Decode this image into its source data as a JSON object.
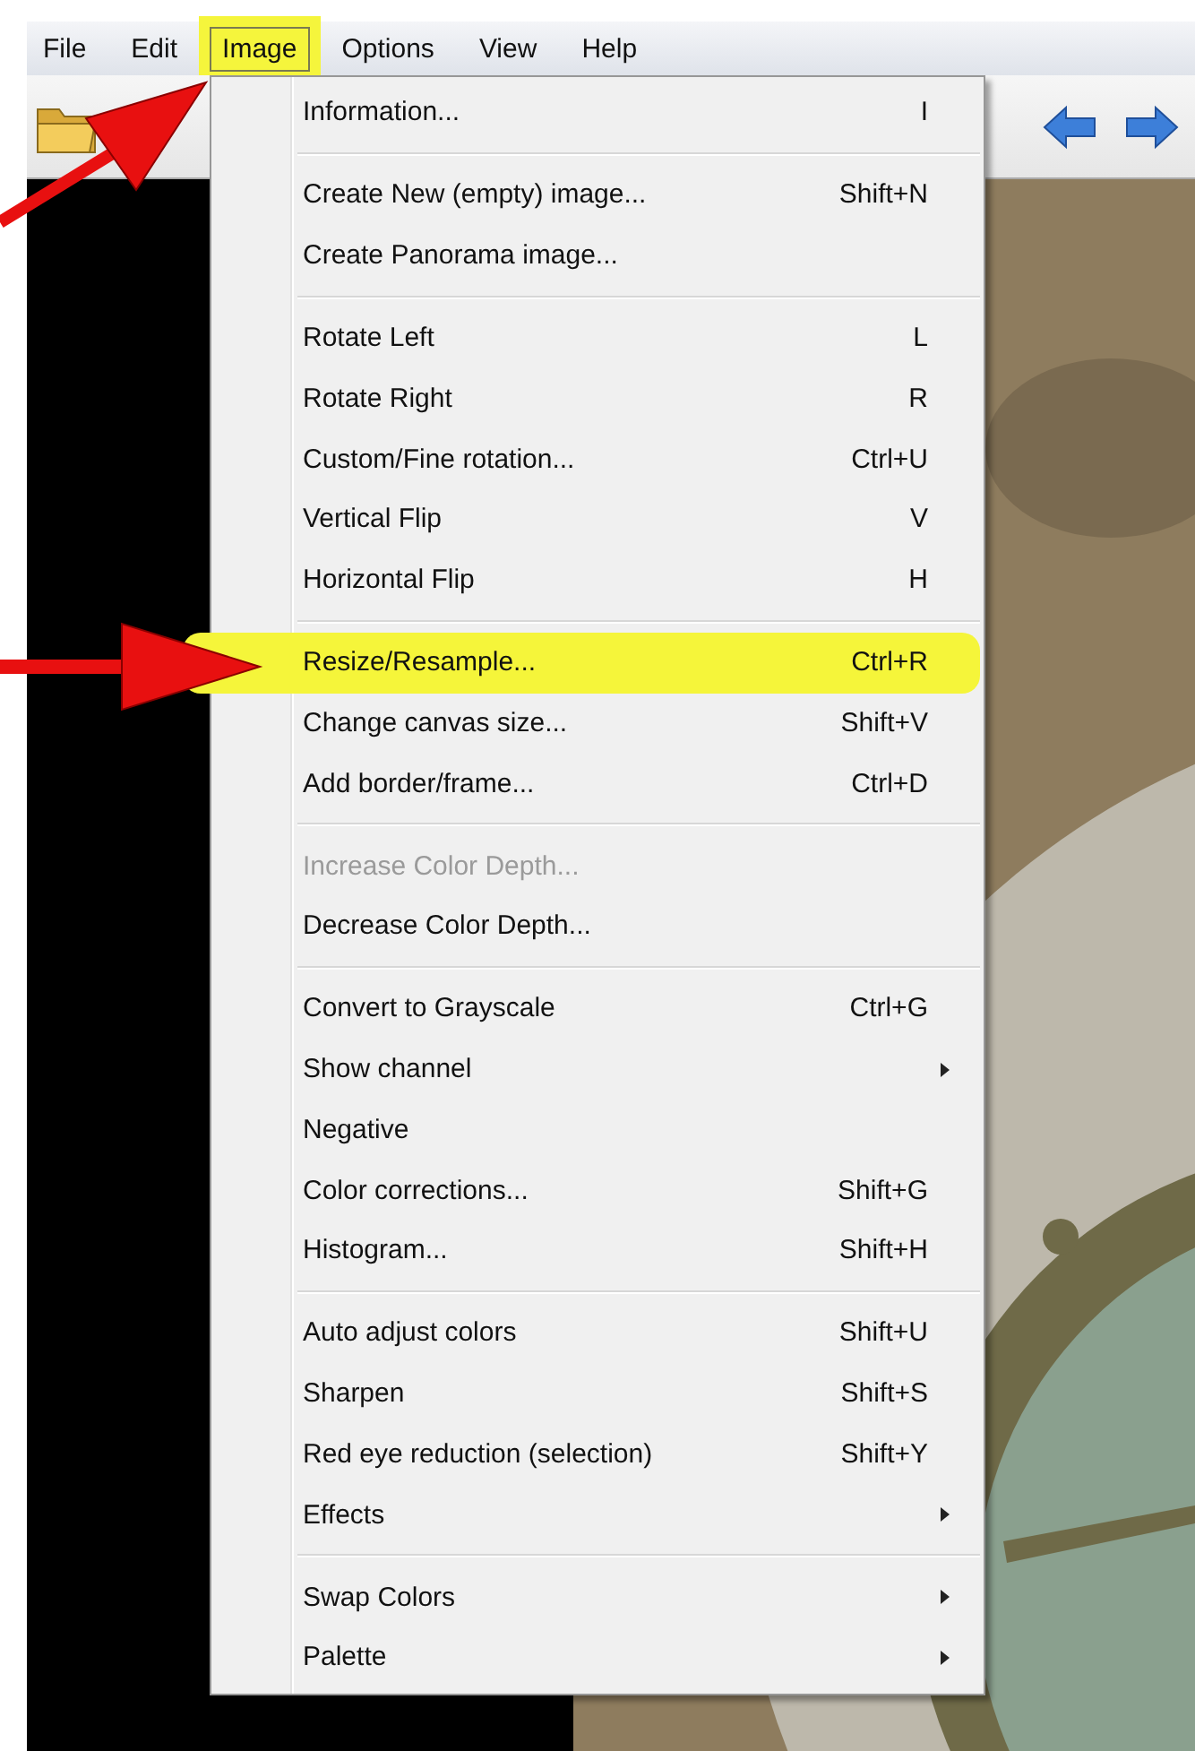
{
  "menubar": [
    {
      "label": "File",
      "selected": false
    },
    {
      "label": "Edit",
      "selected": false
    },
    {
      "label": "Image",
      "selected": true
    },
    {
      "label": "Options",
      "selected": false
    },
    {
      "label": "View",
      "selected": false
    },
    {
      "label": "Help",
      "selected": false
    }
  ],
  "menu": {
    "groups": [
      [
        {
          "label": "Information...",
          "shortcut": "I",
          "disabled": false,
          "submenu": false,
          "highlighted": false
        }
      ],
      [
        {
          "label": "Create New (empty) image...",
          "shortcut": "Shift+N",
          "disabled": false,
          "submenu": false,
          "highlighted": false
        },
        {
          "label": "Create Panorama image...",
          "disabled": false,
          "submenu": false,
          "highlighted": false
        }
      ],
      [
        {
          "label": "Rotate Left",
          "shortcut": "L",
          "disabled": false,
          "submenu": false,
          "highlighted": false
        },
        {
          "label": "Rotate Right",
          "shortcut": "R",
          "disabled": false,
          "submenu": false,
          "highlighted": false
        },
        {
          "label": "Custom/Fine rotation...",
          "shortcut": "Ctrl+U",
          "disabled": false,
          "submenu": false,
          "highlighted": false
        },
        {
          "label": "Vertical Flip",
          "shortcut": "V",
          "disabled": false,
          "submenu": false,
          "highlighted": false
        },
        {
          "label": "Horizontal Flip",
          "shortcut": "H",
          "disabled": false,
          "submenu": false,
          "highlighted": false
        }
      ],
      [
        {
          "label": "Resize/Resample...",
          "shortcut": "Ctrl+R",
          "disabled": false,
          "submenu": false,
          "highlighted": true
        },
        {
          "label": "Change canvas size...",
          "shortcut": "Shift+V",
          "disabled": false,
          "submenu": false,
          "highlighted": false
        },
        {
          "label": "Add border/frame...",
          "shortcut": "Ctrl+D",
          "disabled": false,
          "submenu": false,
          "highlighted": false
        }
      ],
      [
        {
          "label": "Increase Color Depth...",
          "disabled": true,
          "submenu": false,
          "highlighted": false
        },
        {
          "label": "Decrease Color Depth...",
          "disabled": false,
          "submenu": false,
          "highlighted": false
        }
      ],
      [
        {
          "label": "Convert to Grayscale",
          "shortcut": "Ctrl+G",
          "disabled": false,
          "submenu": false,
          "highlighted": false
        },
        {
          "label": "Show channel",
          "disabled": false,
          "submenu": true,
          "highlighted": false
        },
        {
          "label": "Negative",
          "disabled": false,
          "submenu": false,
          "highlighted": false
        },
        {
          "label": "Color corrections...",
          "shortcut": "Shift+G",
          "disabled": false,
          "submenu": false,
          "highlighted": false
        },
        {
          "label": "Histogram...",
          "shortcut": "Shift+H",
          "disabled": false,
          "submenu": false,
          "highlighted": false
        }
      ],
      [
        {
          "label": "Auto adjust colors",
          "shortcut": "Shift+U",
          "disabled": false,
          "submenu": false,
          "highlighted": false
        },
        {
          "label": "Sharpen",
          "shortcut": "Shift+S",
          "disabled": false,
          "submenu": false,
          "highlighted": false
        },
        {
          "label": "Red eye reduction (selection)",
          "shortcut": "Shift+Y",
          "disabled": false,
          "submenu": false,
          "highlighted": false
        },
        {
          "label": "Effects",
          "disabled": false,
          "submenu": true,
          "highlighted": false
        }
      ],
      [
        {
          "label": "Swap Colors",
          "disabled": false,
          "submenu": true,
          "highlighted": false
        },
        {
          "label": "Palette",
          "disabled": false,
          "submenu": true,
          "highlighted": false
        }
      ]
    ]
  }
}
